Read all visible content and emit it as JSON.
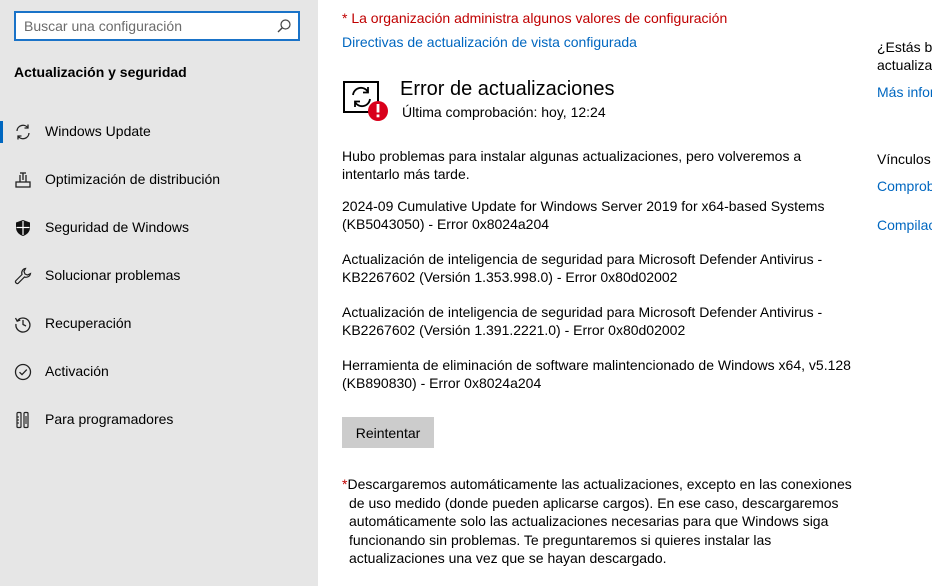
{
  "search": {
    "placeholder": "Buscar una configuración"
  },
  "sidebar": {
    "title": "Actualización y seguridad",
    "items": [
      {
        "label": "Windows Update",
        "icon": "sync-icon",
        "active": true
      },
      {
        "label": "Optimización de distribución",
        "icon": "delivery-optimization-icon"
      },
      {
        "label": "Seguridad de Windows",
        "icon": "shield-icon"
      },
      {
        "label": "Solucionar problemas",
        "icon": "wrench-icon"
      },
      {
        "label": "Recuperación",
        "icon": "history-icon"
      },
      {
        "label": "Activación",
        "icon": "check-circle-icon"
      },
      {
        "label": "Para programadores",
        "icon": "developer-tools-icon"
      }
    ]
  },
  "main": {
    "org_warning": "* La organización administra algunos valores de configuración",
    "policies_link": "Directivas de actualización de vista configurada",
    "status": {
      "title": "Error de actualizaciones",
      "last_check": "Última comprobación: hoy, 12:24"
    },
    "messages": [
      {
        "line1": "Hubo problemas para instalar algunas actualizaciones, pero volveremos a",
        "line2": "intentarlo más tarde."
      },
      {
        "line1": "2024-09 Cumulative Update for Windows Server 2019 for x64-based Systems",
        "line2": "(KB5043050) - Error 0x8024a204"
      },
      {
        "line1": "Actualización de inteligencia de seguridad para Microsoft Defender Antivirus -",
        "line2": "KB2267602 (Versión 1.353.998.0) - Error 0x80d02002"
      },
      {
        "line1": "Actualización de inteligencia de seguridad para Microsoft Defender Antivirus -",
        "line2": "KB2267602 (Versión 1.391.2221.0) - Error 0x80d02002"
      },
      {
        "line1": "Herramienta de eliminación de software malintencionado de Windows x64, v5.128",
        "line2": "(KB890830) - Error 0x8024a204"
      }
    ],
    "retry_label": "Reintentar",
    "footnote": {
      "asterisk": "*",
      "lines": [
        "Descargaremos automáticamente las actualizaciones, excepto en las conexiones",
        "de uso medido (donde pueden aplicarse cargos). En ese caso, descargaremos",
        "automáticamente solo las actualizaciones necesarias para que Windows siga",
        "funcionando sin problemas. Te preguntaremos si quieres instalar las",
        "actualizaciones una vez que se hayan descargado."
      ]
    }
  },
  "right_panel": {
    "question_line1": "¿Estás bu",
    "question_line2": "actualizac",
    "more_info": "Más infor",
    "links_title": "Vínculos",
    "link1": "Comprob",
    "link2": "Compilac"
  },
  "colors": {
    "accent": "#0067c0",
    "warning": "#c00000",
    "error_badge": "#e81123",
    "sidebar_bg": "#e6e6e6"
  }
}
